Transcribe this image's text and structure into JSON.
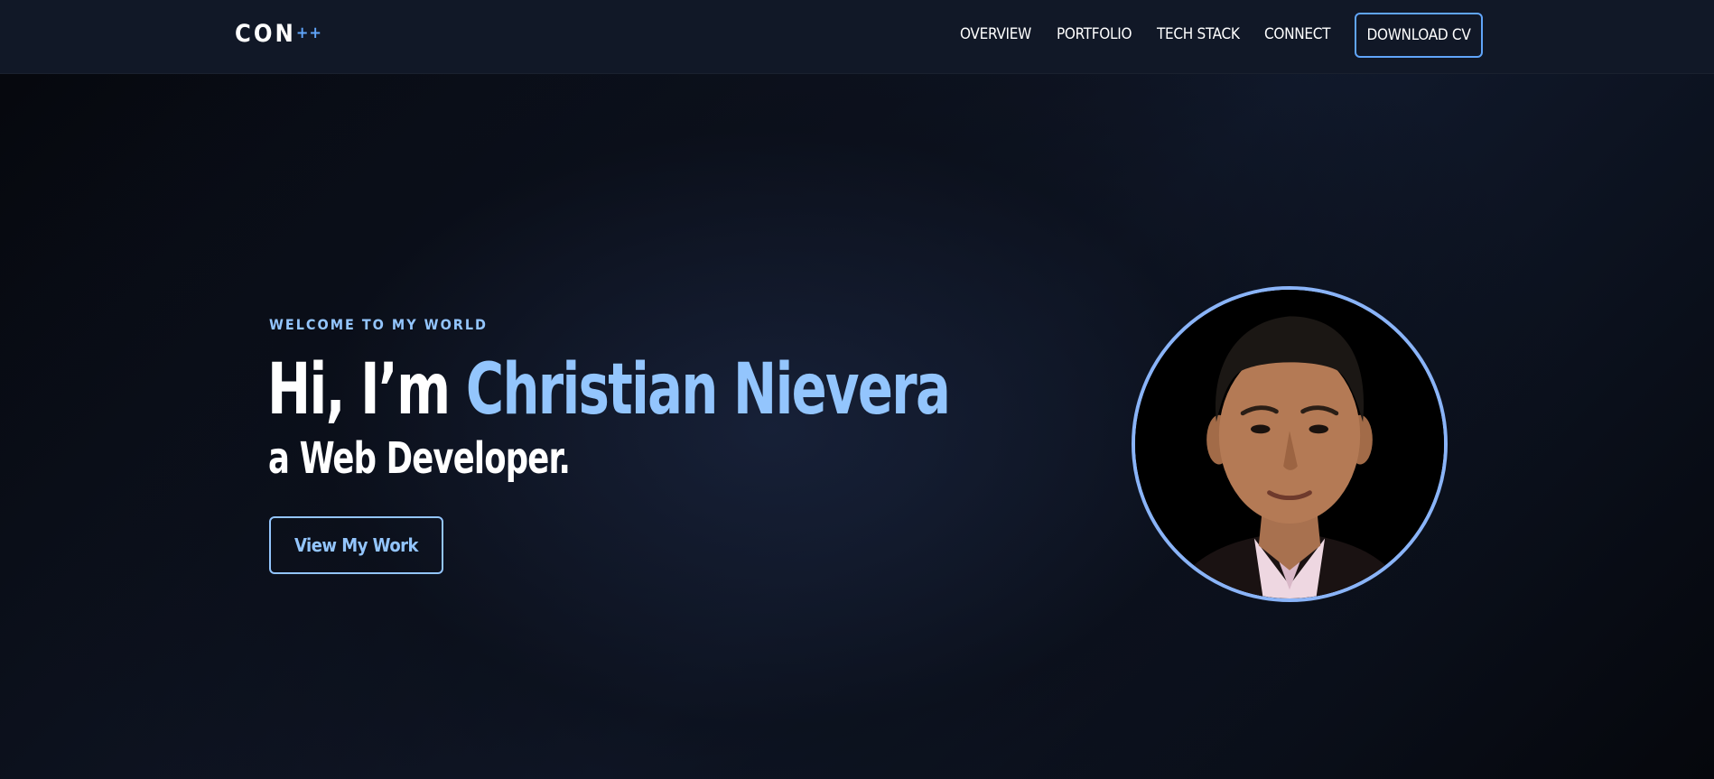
{
  "brand": {
    "name": "CON",
    "suffix": "++"
  },
  "nav": {
    "links": [
      {
        "label": "OVERVIEW"
      },
      {
        "label": "PORTFOLIO"
      },
      {
        "label": "TECH STACK"
      },
      {
        "label": "CONNECT"
      }
    ],
    "cta_label": "DOWNLOAD CV"
  },
  "hero": {
    "eyebrow": "WELCOME TO MY WORLD",
    "title_prefix": "Hi, I’m ",
    "title_name": "Christian Nievera",
    "subtitle": "a Web Developer.",
    "button_label": "View My Work"
  },
  "colors": {
    "accent": "#93c5fd",
    "accent_strong": "#60a5fa",
    "nav_bg": "#111827",
    "page_bg": "#05070c"
  },
  "icons": {
    "profile_photo": "avatar-portrait"
  }
}
